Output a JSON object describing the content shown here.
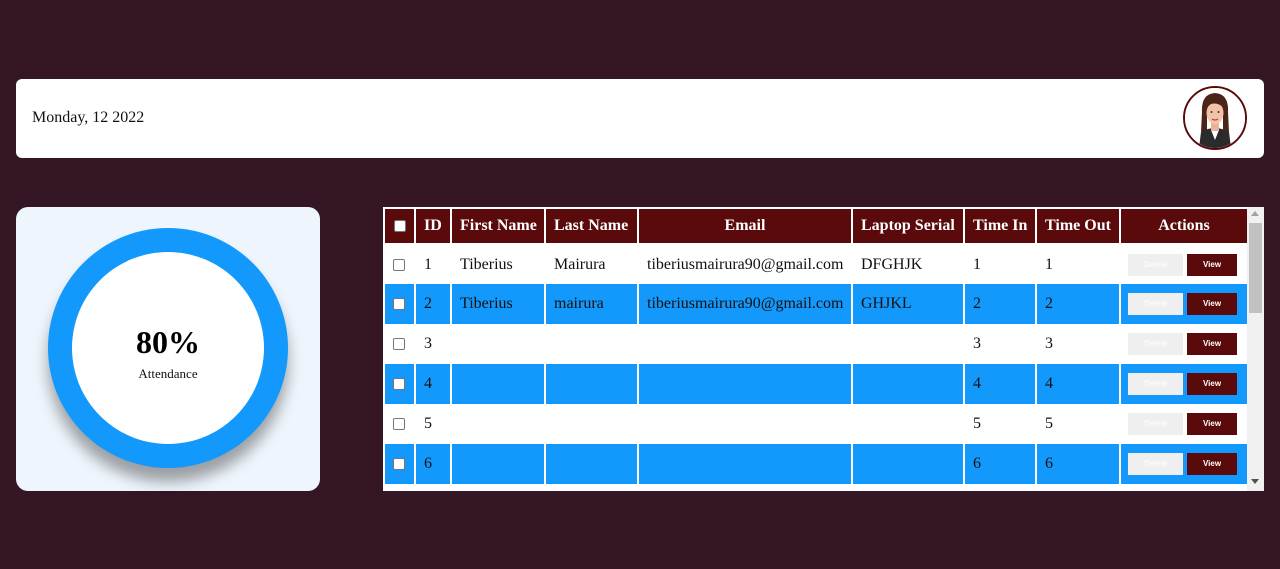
{
  "header": {
    "date": "Monday, 12 2022",
    "avatar_icon": "user-avatar-woman"
  },
  "attendance": {
    "percent": "80%",
    "label": "Attendance",
    "ring_color": "#1399fb"
  },
  "table": {
    "columns": [
      "ID",
      "First Name",
      "Last Name",
      "Email",
      "Laptop Serial",
      "Time In",
      "Time Out",
      "Actions"
    ],
    "rows": [
      {
        "id": "1",
        "first": "Tiberius",
        "last": "Mairura",
        "email": "tiberiusmairura90@gmail.com",
        "serial": "DFGHJK",
        "time_in": "1",
        "time_out": "1"
      },
      {
        "id": "2",
        "first": "Tiberius",
        "last": "mairura",
        "email": "tiberiusmairura90@gmail.com",
        "serial": "GHJKL",
        "time_in": "2",
        "time_out": "2"
      },
      {
        "id": "3",
        "first": "",
        "last": "",
        "email": "",
        "serial": "",
        "time_in": "3",
        "time_out": "3"
      },
      {
        "id": "4",
        "first": "",
        "last": "",
        "email": "",
        "serial": "",
        "time_in": "4",
        "time_out": "4"
      },
      {
        "id": "5",
        "first": "",
        "last": "",
        "email": "",
        "serial": "",
        "time_in": "5",
        "time_out": "5"
      },
      {
        "id": "6",
        "first": "",
        "last": "",
        "email": "",
        "serial": "",
        "time_in": "6",
        "time_out": "6"
      }
    ],
    "delete_label": "Delete",
    "view_label": "View"
  },
  "colors": {
    "background": "#351624",
    "header_row": "#5a0a0a",
    "stripe": "#1399fb",
    "view_button": "#5a0a0a"
  }
}
